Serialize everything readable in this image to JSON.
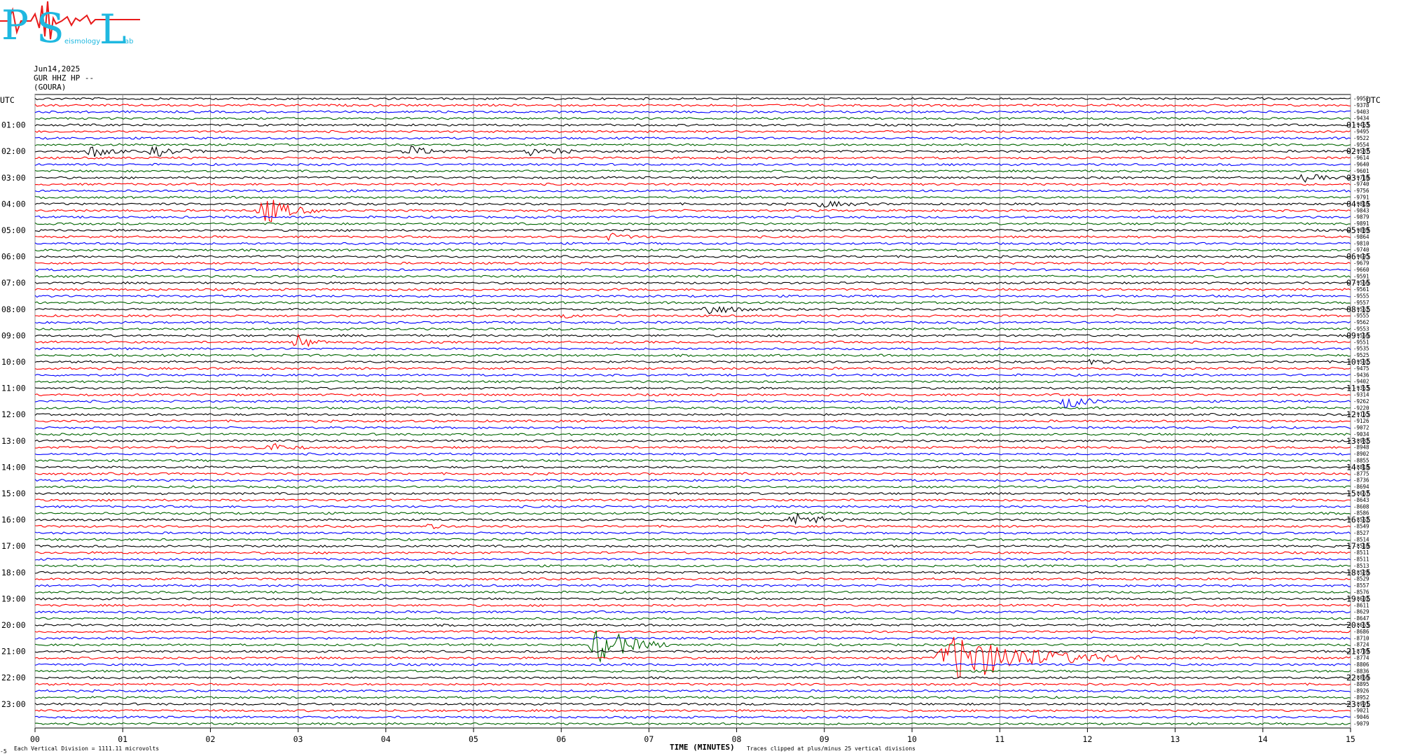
{
  "logo": {
    "letters": [
      "P",
      "S",
      "L"
    ],
    "small_texts": [
      "eismology",
      "ab"
    ],
    "colors": {
      "letters": "#1fb8e0",
      "trace": "#e81b1b"
    }
  },
  "header": {
    "date": "Jun14,2025",
    "channel": "GUR HHZ HP --",
    "station": "(GOURA)"
  },
  "chart_data": {
    "type": "line",
    "title": "",
    "left_axis_title": "UTC",
    "right_axis_title": "UTC",
    "hour_labels_left": [
      "01:00",
      "02:00",
      "03:00",
      "04:00",
      "05:00",
      "06:00",
      "07:00",
      "08:00",
      "09:00",
      "10:00",
      "11:00",
      "12:00",
      "13:00",
      "14:00",
      "15:00",
      "16:00",
      "17:00",
      "18:00",
      "19:00",
      "20:00",
      "21:00",
      "22:00",
      "23:00"
    ],
    "hour_labels_right": [
      "01:15",
      "02:15",
      "03:15",
      "04:15",
      "05:15",
      "06:15",
      "07:15",
      "08:15",
      "09:15",
      "10:15",
      "11:15",
      "12:15",
      "13:15",
      "14:15",
      "15:15",
      "16:15",
      "17:15",
      "18:15",
      "19:15",
      "20:15",
      "21:15",
      "22:15",
      "23:15"
    ],
    "x_ticks": [
      "00",
      "01",
      "02",
      "03",
      "04",
      "05",
      "06",
      "07",
      "08",
      "09",
      "10",
      "11",
      "12",
      "13",
      "14",
      "15"
    ],
    "xlabel": "TIME (MINUTES)",
    "xlim": [
      0,
      15
    ],
    "trace_interval_minutes": 15,
    "trace_count": 96,
    "trace_colors": [
      "#000000",
      "#ff0000",
      "#0000ff",
      "#006400"
    ],
    "offsets": [
      "-9952",
      "-9378",
      "-9403",
      "-9434",
      "-9463",
      "-9495",
      "-9522",
      "-9554",
      "-9587",
      "-9614",
      "-9640",
      "-9601",
      "-9710",
      "-9740",
      "-9756",
      "-9791",
      "-9810",
      "-9843",
      "-9879",
      "-9891",
      "-9889",
      "-9864",
      "-9810",
      "-9740",
      "-9695",
      "-9679",
      "-9660",
      "-9591",
      "-9566",
      "-9561",
      "-9555",
      "-9557",
      "-9562",
      "-9555",
      "-9562",
      "-9553",
      "-9556",
      "-9551",
      "-9535",
      "-9525",
      "-9502",
      "-9475",
      "-9436",
      "-9402",
      "-9353",
      "-9314",
      "-9262",
      "-9220",
      "-9165",
      "-9126",
      "-9072",
      "-9034",
      "-8982",
      "-8948",
      "-8902",
      "-8855",
      "-8818",
      "-8775",
      "-8736",
      "-8694",
      "-8667",
      "-8643",
      "-8608",
      "-8586",
      "-8562",
      "-8549",
      "-8527",
      "-8514",
      "-8510",
      "-8511",
      "-8511",
      "-8513",
      "-8528",
      "-8529",
      "-8557",
      "-8576",
      "-8602",
      "-8611",
      "-8629",
      "-8647",
      "-8663",
      "-8686",
      "-8710",
      "-8724",
      "-8749",
      "-8774",
      "-8806",
      "-8836",
      "-8866",
      "-8895",
      "-8926",
      "-8952",
      "-8991",
      "-9021",
      "-9046",
      "-9079"
    ],
    "events": [
      {
        "trace": 8,
        "minute": 0.6,
        "amplitude": 9,
        "duration": 0.5
      },
      {
        "trace": 8,
        "minute": 1.3,
        "amplitude": 7,
        "duration": 0.7
      },
      {
        "trace": 8,
        "minute": 4.2,
        "amplitude": 7,
        "duration": 0.7
      },
      {
        "trace": 8,
        "minute": 5.6,
        "amplitude": 6,
        "duration": 0.4
      },
      {
        "trace": 8,
        "minute": 5.95,
        "amplitude": 6,
        "duration": 0.2
      },
      {
        "trace": 12,
        "minute": 14.4,
        "amplitude": 5,
        "duration": 0.7
      },
      {
        "trace": 16,
        "minute": 8.9,
        "amplitude": 4,
        "duration": 0.8
      },
      {
        "trace": 17,
        "minute": 2.55,
        "amplitude": 22,
        "duration": 0.7
      },
      {
        "trace": 21,
        "minute": 6.5,
        "amplitude": 5,
        "duration": 0.5
      },
      {
        "trace": 32,
        "minute": 7.6,
        "amplitude": 8,
        "duration": 0.7
      },
      {
        "trace": 33,
        "minute": 6.0,
        "amplitude": 5,
        "duration": 0.3
      },
      {
        "trace": 37,
        "minute": 2.95,
        "amplitude": 12,
        "duration": 0.4
      },
      {
        "trace": 40,
        "minute": 12.0,
        "amplitude": 5,
        "duration": 0.3
      },
      {
        "trace": 46,
        "minute": 11.7,
        "amplitude": 10,
        "duration": 0.6
      },
      {
        "trace": 53,
        "minute": 2.55,
        "amplitude": 8,
        "duration": 0.6
      },
      {
        "trace": 64,
        "minute": 8.6,
        "amplitude": 9,
        "duration": 0.8
      },
      {
        "trace": 65,
        "minute": 4.47,
        "amplitude": 6,
        "duration": 0.2
      },
      {
        "trace": 83,
        "minute": 6.35,
        "amplitude": 28,
        "duration": 0.9
      },
      {
        "trace": 85,
        "minute": 10.3,
        "amplitude": 34,
        "duration": 2.3
      }
    ],
    "footnote_left": "Each Vertical Division = 1111.11 microvolts",
    "footnote_right": "Traces clipped at plus/minus 25 vertical divisions",
    "corner_mark": "-5"
  }
}
